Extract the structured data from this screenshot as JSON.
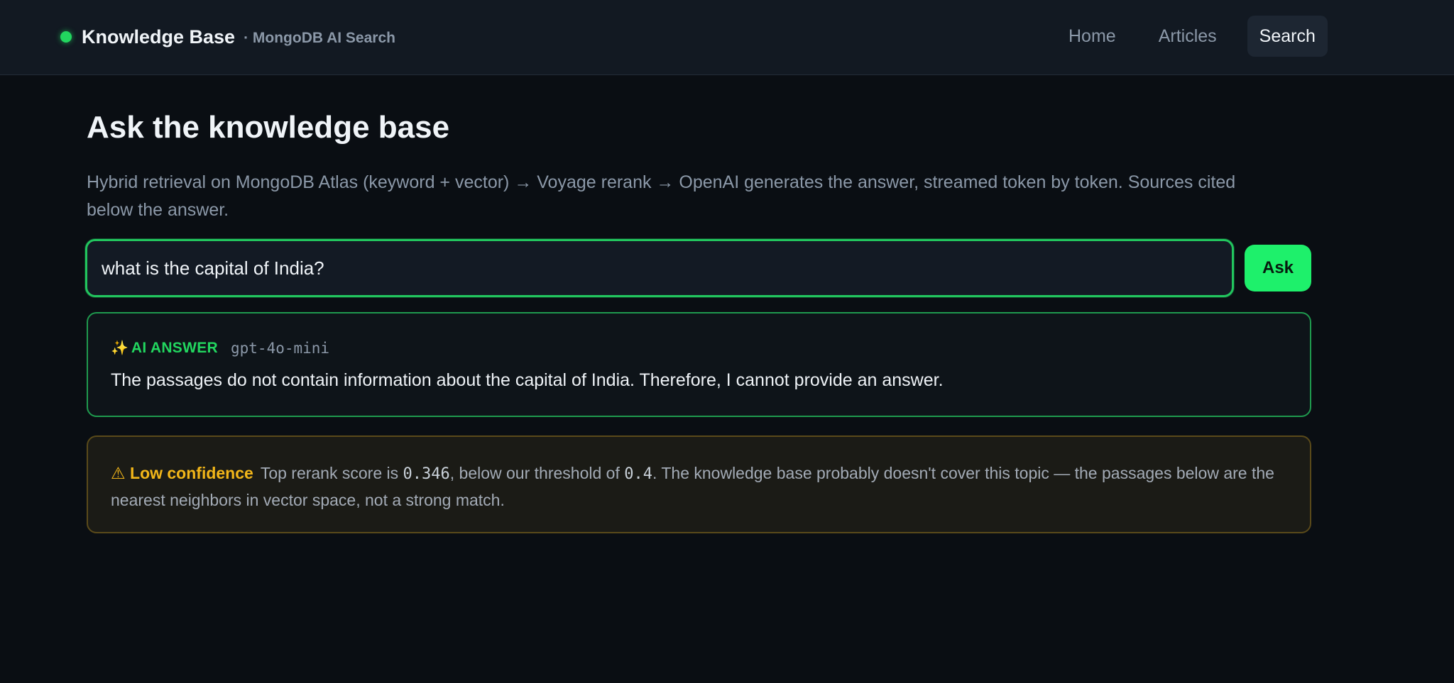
{
  "brand": {
    "title": "Knowledge Base",
    "subtitle": "· MongoDB AI Search",
    "status_color": "#22d65f"
  },
  "nav": {
    "items": [
      {
        "label": "Home"
      },
      {
        "label": "Articles"
      },
      {
        "label": "Search"
      }
    ],
    "active": "Search"
  },
  "page": {
    "title": "Ask the knowledge base",
    "description": "Hybrid retrieval on MongoDB Atlas (keyword + vector) → Voyage rerank → OpenAI generates the answer, streamed token by token. Sources cited below the answer."
  },
  "search": {
    "value": "what is the capital of India?",
    "button_label": "Ask"
  },
  "answer": {
    "icon": "sparkle-icon",
    "label": "AI ANSWER",
    "model": "gpt-4o-mini",
    "text": "The passages do not contain information about the capital of India. Therefore, I cannot provide an answer."
  },
  "warning": {
    "icon": "warning-icon",
    "label": "Low confidence",
    "text_before": "Top rerank score is ",
    "score": "0.346",
    "text_middle": ", below our threshold of ",
    "threshold": "0.4",
    "text_after": ". The knowledge base probably doesn't cover this topic — the passages below are the nearest neighbors in vector space, not a strong match."
  },
  "colors": {
    "accent": "#22d65f",
    "button": "#1ef06b",
    "warning": "#f2b619",
    "background": "#0a0e13"
  }
}
